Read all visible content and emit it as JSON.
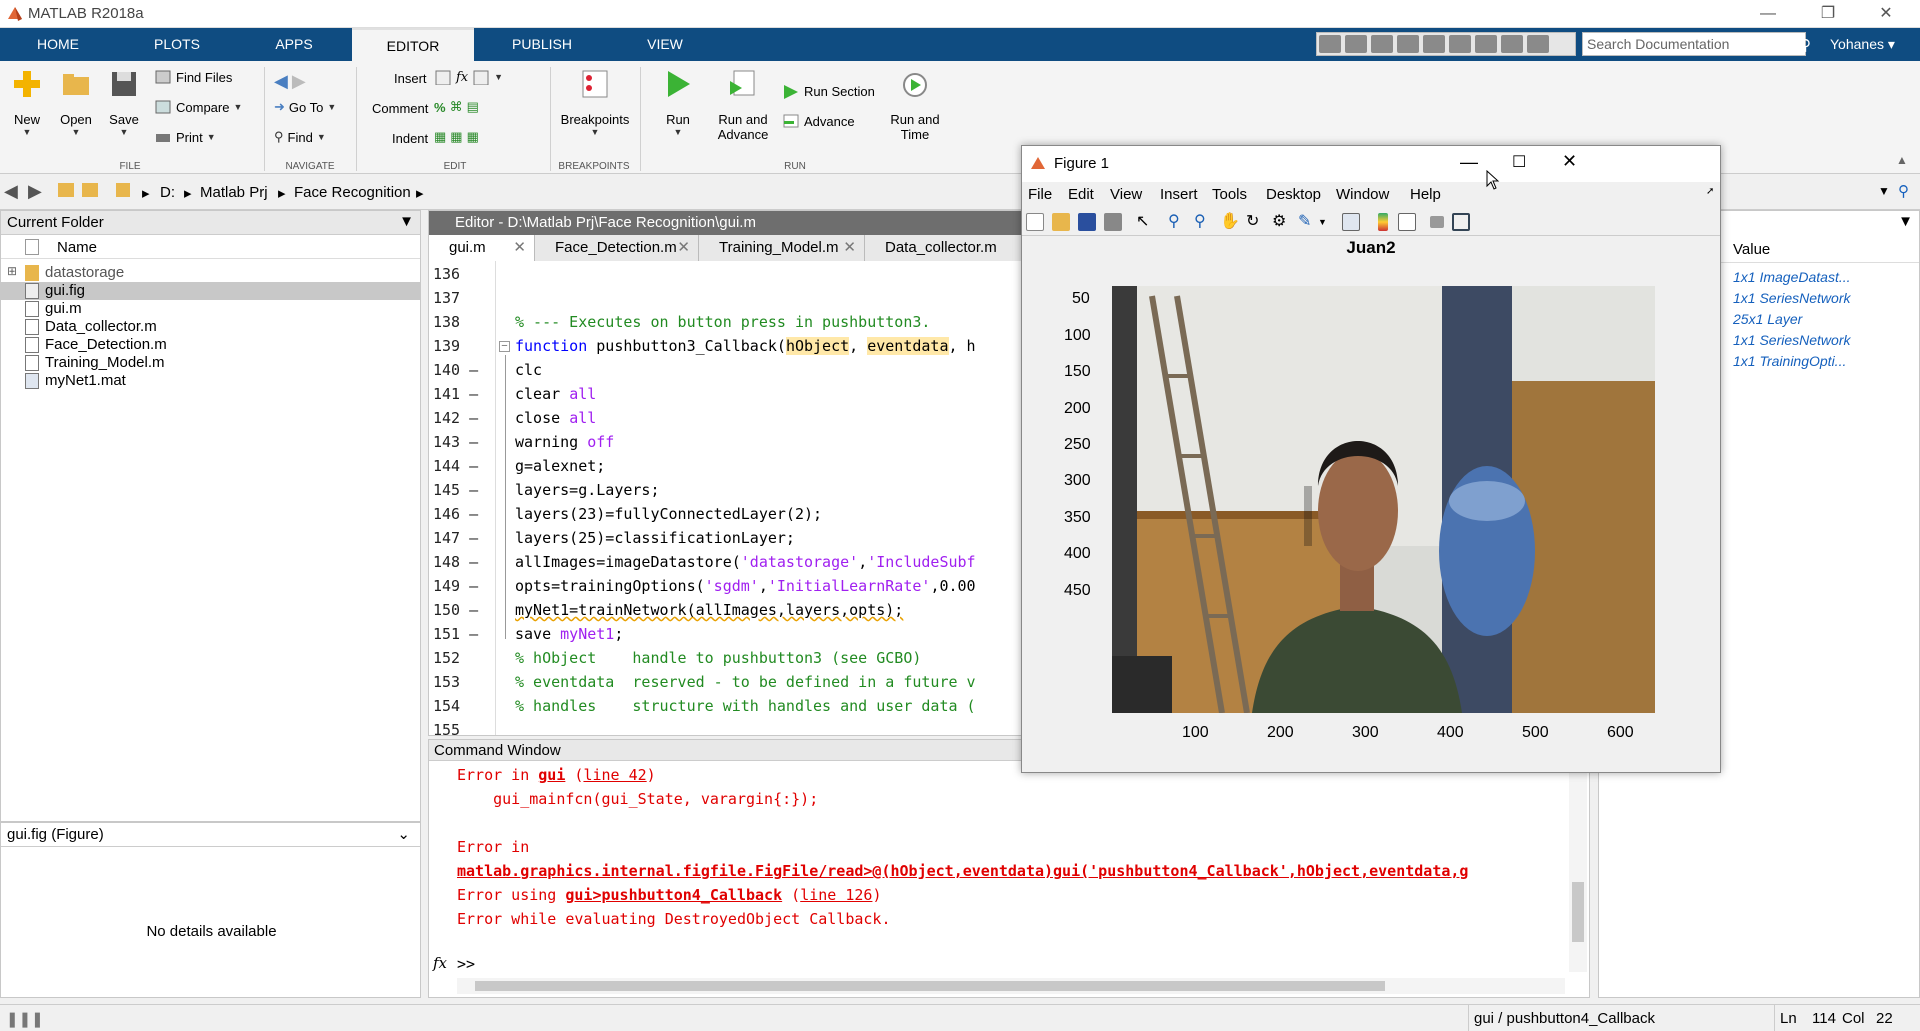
{
  "app": {
    "title": "MATLAB R2018a",
    "user": "Yohanes",
    "search_placeholder": "Search Documentation"
  },
  "ribbon_tabs": [
    "HOME",
    "PLOTS",
    "APPS",
    "EDITOR",
    "PUBLISH",
    "VIEW"
  ],
  "ribbon": {
    "file": {
      "label": "FILE",
      "new": "New",
      "open": "Open",
      "save": "Save",
      "find_files": "Find Files",
      "compare": "Compare",
      "print": "Print"
    },
    "navigate": {
      "label": "NAVIGATE",
      "go_to": "Go To",
      "find": "Find"
    },
    "edit": {
      "label": "EDIT",
      "insert": "Insert",
      "comment": "Comment",
      "indent": "Indent",
      "fx": "fx"
    },
    "breakpoints": {
      "label": "BREAKPOINTS",
      "breakpoints": "Breakpoints"
    },
    "run": {
      "label": "RUN",
      "run": "Run",
      "run_and_advance_1": "Run and",
      "run_and_advance_2": "Advance",
      "run_section": "Run Section",
      "advance": "Advance",
      "run_and_time_1": "Run and",
      "run_and_time_2": "Time"
    }
  },
  "address": {
    "drive": "D:",
    "folder1": "Matlab Prj",
    "folder2": "Face Recognition"
  },
  "current_folder": {
    "title": "Current Folder",
    "name_header": "Name",
    "items": [
      "datastorage",
      "gui.fig",
      "gui.m",
      "Data_collector.m",
      "Face_Detection.m",
      "Training_Model.m",
      "myNet1.mat"
    ],
    "details_title": "gui.fig  (Figure)",
    "no_details": "No details available"
  },
  "editor": {
    "title": "Editor - D:\\Matlab Prj\\Face Recognition\\gui.m",
    "tabs": [
      "gui.m",
      "Face_Detection.m",
      "Training_Model.m",
      "Data_collector.m"
    ],
    "line_numbers": [
      "136",
      "137",
      "138",
      "139",
      "140 –",
      "141 –",
      "142 –",
      "143 –",
      "144 –",
      "145 –",
      "146 –",
      "147 –",
      "148 –",
      "149 –",
      "150 –",
      "151 –",
      "152",
      "153",
      "154",
      "155"
    ],
    "code": {
      "l138": "% --- Executes on button press in pushbutton3.",
      "l139_kw": "function",
      "l139_a": " pushbutton3_Callback(",
      "l139_b": "hObject",
      ", ": ", ",
      "l139_c": "eventdata",
      "l139_d": ", h",
      "l140": "clc",
      "l141_a": "clear ",
      "l141_b": "all",
      "l142_a": "close ",
      "l142_b": "all",
      "l143_a": "warning ",
      "l143_b": "off",
      "l144": "g=alexnet;",
      "l145": "layers=g.Layers;",
      "l146": "layers(23)=fullyConnectedLayer(2);",
      "l147": "layers(25)=classificationLayer;",
      "l148_a": "allImages=imageDatastore(",
      "l148_b": "'datastorage'",
      "l148_c": ",",
      "l148_d": "'IncludeSubf",
      "l149_a": "opts=trainingOptions(",
      "l149_b": "'sgdm'",
      "l149_c": ",",
      "l149_d": "'InitialLearnRate'",
      "l149_e": ",0.00",
      "l150": "myNet1=trainNetwork(allImages,layers,opts);",
      "l151_a": "save ",
      "l151_b": "myNet1",
      ";": ";",
      "l152": "% hObject    handle to pushbutton3 (see GCBO)",
      "l153": "% eventdata  reserved - to be defined in a future v",
      "l154": "% handles    structure with handles and user data ("
    }
  },
  "command_window": {
    "title": "Command Window",
    "l1_a": "Error in ",
    "l1_b": "gui",
    "l1_c": " (",
    "l1_d": "line 42",
    ")": ")",
    "l2": "    gui_mainfcn(gui_State, varargin{:});",
    "l3": "Error in",
    "l4": "matlab.graphics.internal.figfile.FigFile/read>@(hObject,eventdata)gui('pushbutton4_Callback',hObject,eventdata,g",
    "l5_a": "Error using ",
    "l5_b": "gui>pushbutton4_Callback",
    "l5_c": " (",
    "l5_d": "line 126",
    "l6": "Error while evaluating DestroyedObject Callback.",
    "prompt": ">>",
    "fx": "fx"
  },
  "workspace": {
    "value_header": "Value",
    "values": [
      "1x1 ImageDatast...",
      "1x1 SeriesNetwork",
      "25x1 Layer",
      "1x1 SeriesNetwork",
      "1x1 TrainingOpti..."
    ]
  },
  "figure": {
    "title": "Figure 1",
    "menu": [
      "File",
      "Edit",
      "View",
      "Insert",
      "Tools",
      "Desktop",
      "Window",
      "Help"
    ],
    "plot_title": "Juan2",
    "yticks": [
      "50",
      "100",
      "150",
      "200",
      "250",
      "300",
      "350",
      "400",
      "450"
    ],
    "xticks": [
      "100",
      "200",
      "300",
      "400",
      "500",
      "600"
    ]
  },
  "status": {
    "function": "gui / pushbutton4_Callback",
    "ln_label": "Ln",
    "ln": "114",
    "col_label": "Col",
    "col": "22"
  }
}
